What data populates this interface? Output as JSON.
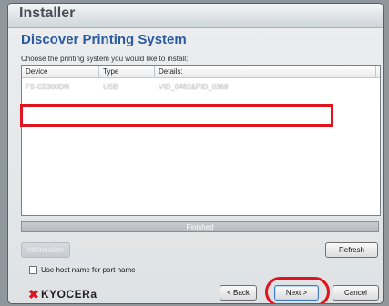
{
  "window": {
    "title": "Installer",
    "heading": "Discover Printing System",
    "instruction": "Choose the printing system you would like to install:"
  },
  "table": {
    "columns": [
      "Device",
      "Type",
      "Details:"
    ],
    "rows": [
      {
        "device": "FS-C5300DN",
        "type": "USB",
        "details": "VID_0482&PID_0368"
      }
    ]
  },
  "progress": {
    "text": "Finished",
    "value": 1.0
  },
  "buttons": {
    "information": "Information",
    "refresh": "Refresh",
    "back": "< Back",
    "next": "Next >",
    "cancel": "Cancel"
  },
  "checkbox": {
    "label": "Use host name for port name",
    "checked": false
  },
  "logo": {
    "text": "KYOCERa"
  },
  "colors": {
    "heading": "#2c5aa0",
    "highlight": "#e0141e"
  }
}
